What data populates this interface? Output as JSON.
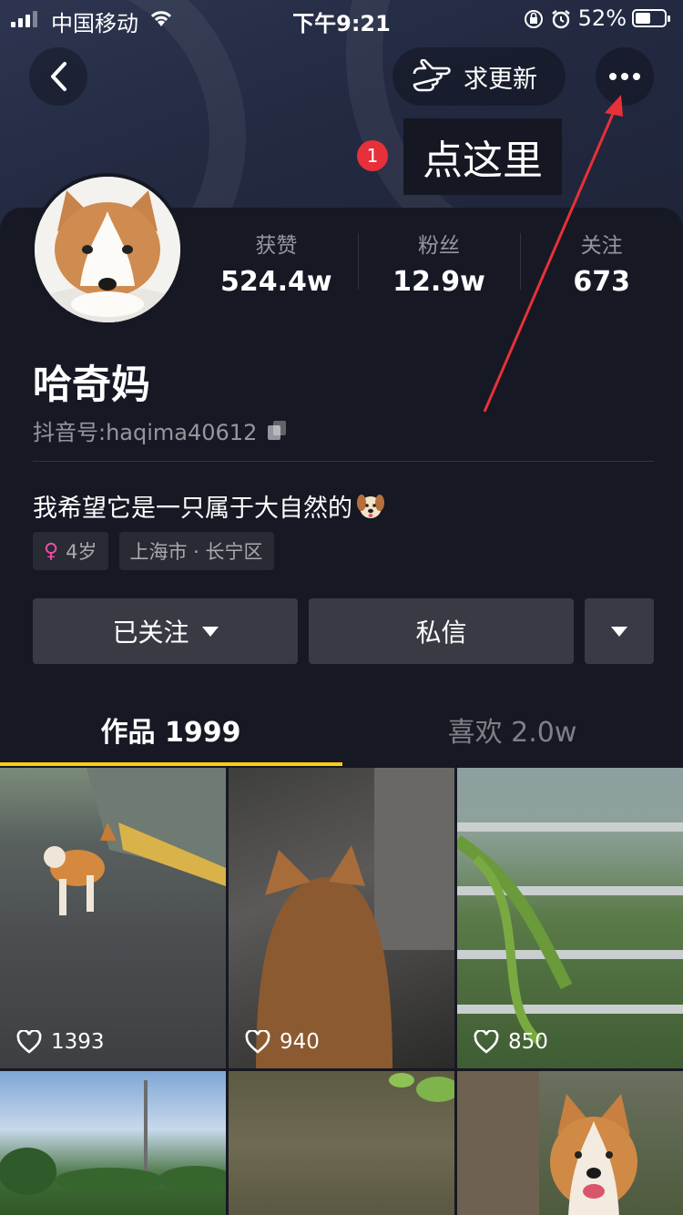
{
  "status_bar": {
    "carrier": "中国移动",
    "time": "下午9:21",
    "battery": "52%",
    "battery_level": 0.52
  },
  "header": {
    "request_update_label": "求更新"
  },
  "annotation": {
    "badge_number": "1",
    "text": "点这里",
    "arrow_color": "#e8303a"
  },
  "profile": {
    "stats": [
      {
        "label": "获赞",
        "value": "524.4w"
      },
      {
        "label": "粉丝",
        "value": "12.9w"
      },
      {
        "label": "关注",
        "value": "673"
      }
    ],
    "nickname": "哈奇妈",
    "douyin_id": "抖音号:haqima40612",
    "bio": "我希望它是一只属于大自然的",
    "tags": {
      "age": "4岁",
      "location": "上海市 · 长宁区"
    }
  },
  "actions": {
    "follow_label": "已关注",
    "message_label": "私信"
  },
  "tabs": [
    {
      "label": "作品 1999",
      "active": true
    },
    {
      "label": "喜欢 2.0w",
      "active": false
    }
  ],
  "videos": [
    {
      "likes": "1393"
    },
    {
      "likes": "940"
    },
    {
      "likes": "850"
    }
  ],
  "colors": {
    "background": "#161823",
    "button": "#393b44",
    "tab_accent": "#face15",
    "female_icon": "#f04ea7"
  },
  "icons": [
    "back-icon",
    "pointing-hand-icon",
    "more-dots-icon",
    "copy-icon",
    "female-icon",
    "heart-icon",
    "caret-down-icon",
    "wifi-icon",
    "alarm-icon",
    "rotation-lock-icon"
  ]
}
